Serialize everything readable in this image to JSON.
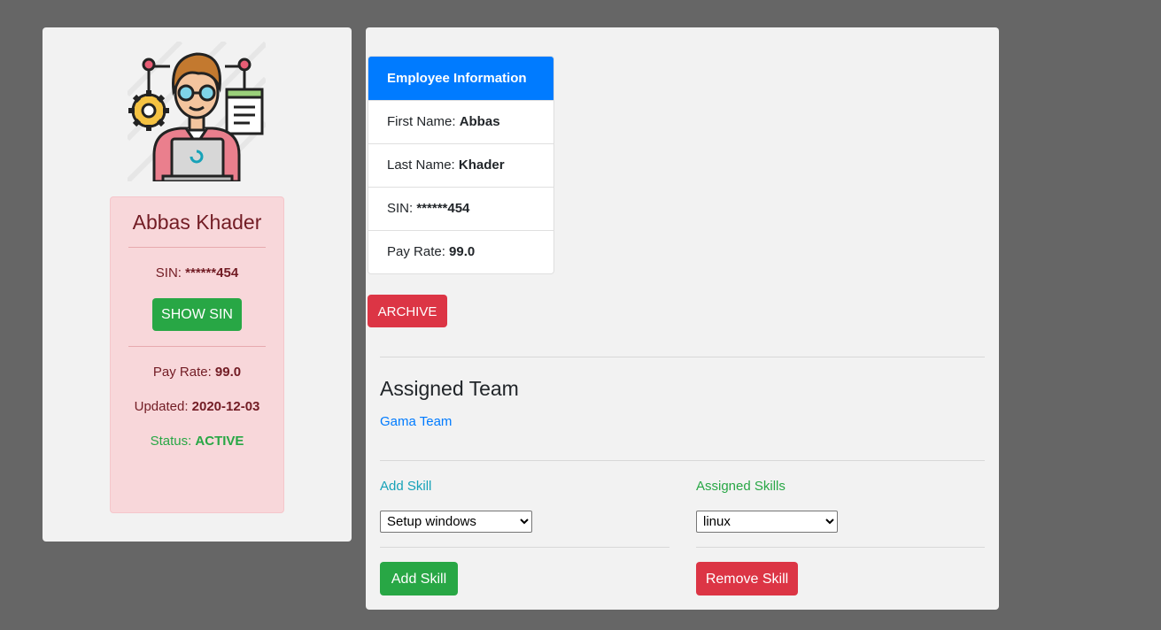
{
  "profile": {
    "avatar_icon": "developer-avatar-icon",
    "name": "Abbas Khader",
    "sin_label": "SIN: ",
    "sin_value": "******454",
    "show_sin_label": "SHOW SIN",
    "pay_label": "Pay Rate: ",
    "pay_value": "99.0",
    "updated_label": "Updated: ",
    "updated_value": "2020-12-03",
    "status_label": "Status: ",
    "status_value": "ACTIVE"
  },
  "info": {
    "header": "Employee Information",
    "rows": [
      {
        "label": "First Name: ",
        "value": "Abbas"
      },
      {
        "label": "Last Name: ",
        "value": "Khader"
      },
      {
        "label": "SIN: ",
        "value": "******454"
      },
      {
        "label": "Pay Rate: ",
        "value": "99.0"
      }
    ]
  },
  "archive_label": "ARCHIVE",
  "team": {
    "title": "Assigned Team",
    "name": "Gama Team"
  },
  "skills": {
    "add_label": "Add Skill",
    "assigned_label": "Assigned Skills",
    "add_selected": "Setup windows",
    "assigned_selected": "linux",
    "add_button": "Add Skill",
    "remove_button": "Remove Skill"
  },
  "colors": {
    "background": "#666666",
    "card": "#f2f2f2",
    "primary": "#007bff",
    "success": "#28a745",
    "danger": "#dc3545",
    "info": "#17a2b8",
    "alert_bg": "#f8d7da",
    "alert_text": "#721c24"
  }
}
